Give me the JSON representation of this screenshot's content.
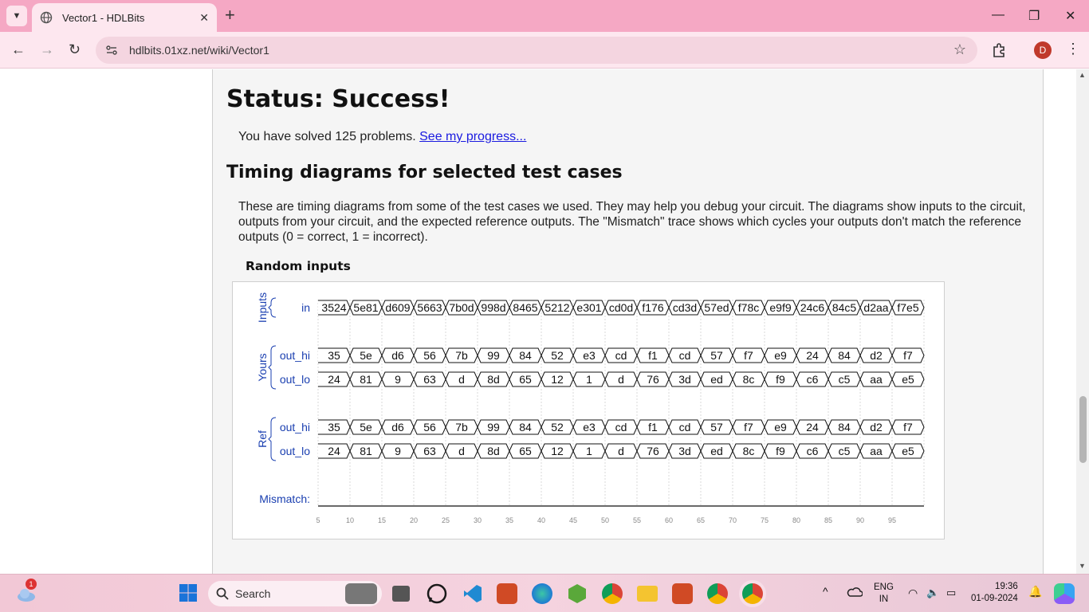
{
  "browser": {
    "tab_title": "Vector1 - HDLBits",
    "url": "hdlbits.01xz.net/wiki/Vector1",
    "profile_initial": "D",
    "accent": "#f5a8c4"
  },
  "page": {
    "status_title": "Status: Success!",
    "solved_text": "You have solved 125 problems.",
    "progress_link": "See my progress...",
    "timing_heading": "Timing diagrams for selected test cases",
    "description": "These are timing diagrams from some of the test cases we used. They may help you debug your circuit. The diagrams show inputs to the circuit, outputs from your circuit, and the expected reference outputs. The \"Mismatch\" trace shows which cycles your outputs don't match the reference outputs (0 = correct, 1 = incorrect).",
    "random_inputs_label": "Random inputs"
  },
  "waveform": {
    "groups": [
      {
        "label": "Inputs",
        "signals": [
          "in"
        ]
      },
      {
        "label": "Yours",
        "signals": [
          "out_hi",
          "out_lo"
        ]
      },
      {
        "label": "Ref",
        "signals": [
          "out_hi",
          "out_lo"
        ]
      }
    ],
    "mismatch_label": "Mismatch:",
    "in_values": [
      "3524",
      "5e81",
      "d609",
      "5663",
      "7b0d",
      "998d",
      "8465",
      "5212",
      "e301",
      "cd0d",
      "f176",
      "cd3d",
      "57ed",
      "f78c",
      "e9f9",
      "24c6",
      "84c5",
      "d2aa",
      "f7e5"
    ],
    "out_hi_values": [
      "35",
      "5e",
      "d6",
      "56",
      "7b",
      "99",
      "84",
      "52",
      "e3",
      "cd",
      "f1",
      "cd",
      "57",
      "f7",
      "e9",
      "24",
      "84",
      "d2",
      "f7"
    ],
    "out_lo_values": [
      "24",
      "81",
      "9",
      "63",
      "d",
      "8d",
      "65",
      "12",
      "1",
      "d",
      "76",
      "3d",
      "ed",
      "8c",
      "f9",
      "c6",
      "c5",
      "aa",
      "e5"
    ],
    "time_ticks": [
      "5",
      "10",
      "15",
      "20",
      "25",
      "30",
      "35",
      "40",
      "45",
      "50",
      "55",
      "60",
      "65",
      "70",
      "75",
      "80",
      "85",
      "90",
      "95"
    ],
    "label_color": "#1a3fb0"
  },
  "taskbar": {
    "weather_badge": "1",
    "search_label": "Search",
    "lang_line1": "ENG",
    "lang_line2": "IN",
    "time": "19:36",
    "date": "01-09-2024"
  }
}
